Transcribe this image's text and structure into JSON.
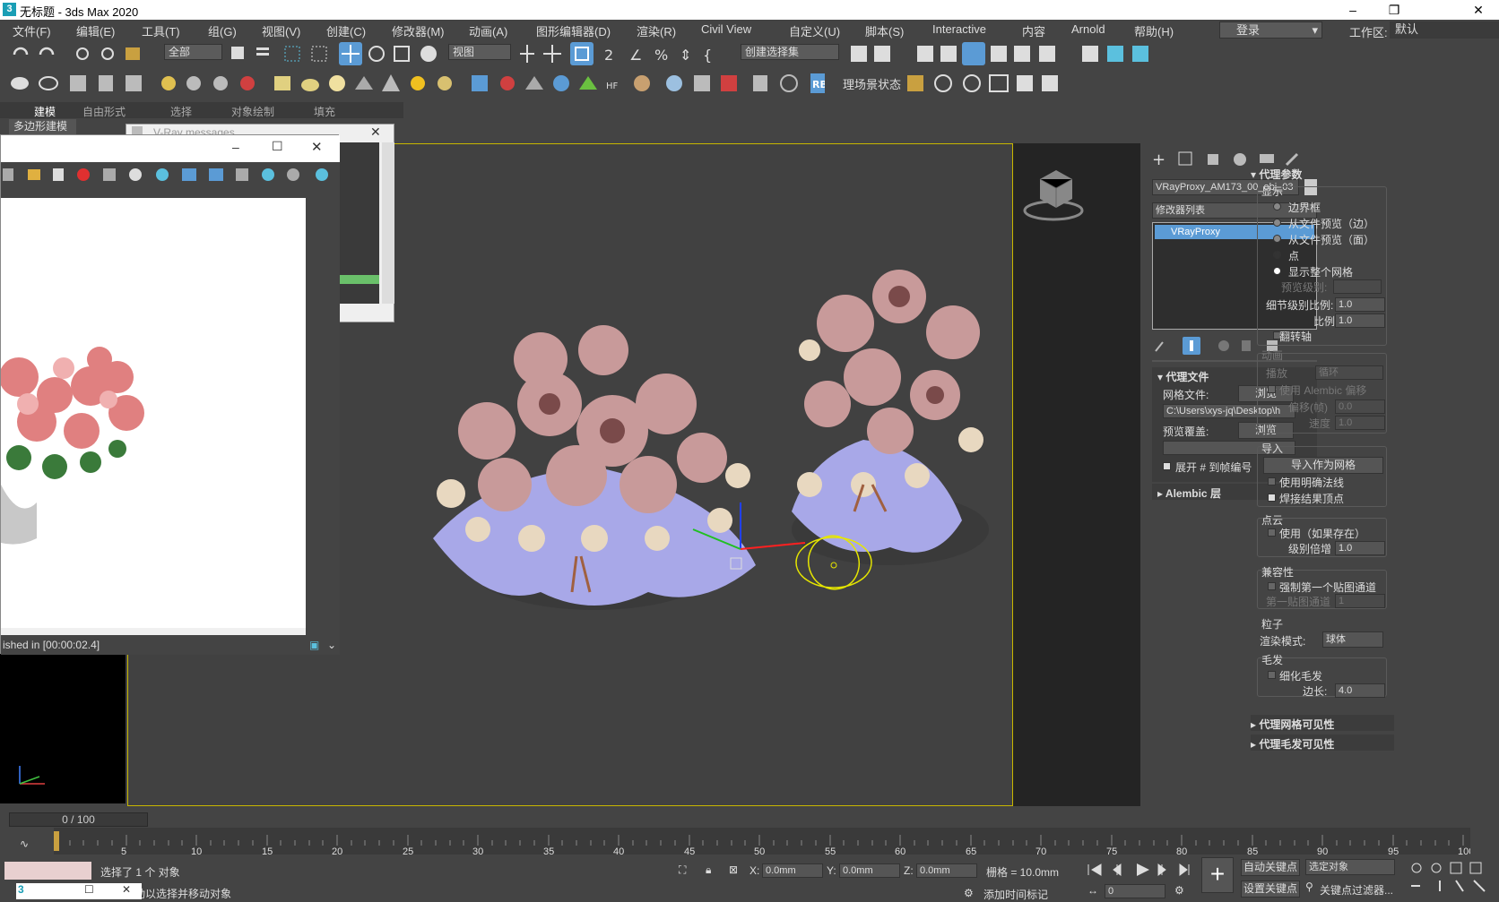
{
  "window": {
    "title": "无标题 - 3ds Max 2020",
    "min_icon": "minimize-icon",
    "max_icon": "maximize-icon",
    "close_icon": "close-icon"
  },
  "menu": [
    "文件(F)",
    "编辑(E)",
    "工具(T)",
    "组(G)",
    "视图(V)",
    "创建(C)",
    "修改器(M)",
    "动画(A)",
    "图形编辑器(D)",
    "渲染(R)",
    "Civil View",
    "自定义(U)",
    "脚本(S)",
    "Interactive",
    "内容",
    "Arnold",
    "帮助(H)"
  ],
  "login": "登录",
  "workspace": {
    "label": "工作区:",
    "value": "默认"
  },
  "toolbar": {
    "selection_filter": "全部",
    "coord_system": "视图",
    "named_selection": "创建选择集",
    "scene_explorer": "理场景状态"
  },
  "ribbon": {
    "tabs": [
      "建模",
      "自由形式",
      "选择",
      "对象绘制",
      "填充"
    ],
    "sub": "多边形建模"
  },
  "vray_messages": {
    "title": "V-Ray messages"
  },
  "vfb": {
    "status": "ished in [00:00:02.4]"
  },
  "cmd": {
    "object_name": "VRayProxy_AM173_00_obj_03",
    "modifier_list": "修改器列表",
    "stack_item": "VRayProxy",
    "proxy_file": {
      "title": "代理文件",
      "mesh_label": "网格文件:",
      "browse": "浏览",
      "path": "C:\\Users\\xys-jq\\Desktop\\h",
      "preview_label": "预览覆盖:",
      "browse2": "浏览",
      "expand": "展开 # 到帧编号"
    },
    "alembic": "Alembic 层",
    "params": {
      "title": "代理参数",
      "display": "显示",
      "radios": [
        "边界框",
        "从文件预览（边）",
        "从文件预览（面）",
        "点",
        "显示整个网格"
      ],
      "preview_level": "预览级别:",
      "lod_label": "细节级别比例:",
      "lod_val": "1.0",
      "scale_label": "比例:",
      "scale_val": "1.0",
      "flip": "翻转轴"
    },
    "anim": {
      "title": "动画",
      "playback": "播放",
      "playback_val": "循环",
      "alembic_offset": "使用 Alembic 偏移",
      "offset_label": "偏移(帧)",
      "offset_val": "0.0",
      "speed_label": "速度",
      "speed_val": "1.0"
    },
    "import": {
      "title": "导入",
      "button": "导入作为网格",
      "normals": "使用明确法线",
      "weld": "焊接结果顶点"
    },
    "pointcloud": {
      "title": "点云",
      "use": "使用（如果存在）",
      "level_label": "级别倍增",
      "level_val": "1.0"
    },
    "compat": {
      "title": "兼容性",
      "force": "强制第一个贴图通道",
      "channel": "第一贴图通道",
      "channel_val": "1"
    },
    "particles": {
      "title": "粒子",
      "mode_label": "渲染模式:",
      "mode_val": "球体"
    },
    "hair": {
      "title": "毛发",
      "subdiv": "细化毛发",
      "edge_label": "边长:",
      "edge_val": "4.0"
    },
    "rollouts": [
      "代理网格可见性",
      "代理毛发可见性"
    ]
  },
  "timeline": {
    "frame": "0 / 100",
    "ticks": [
      5,
      10,
      15,
      20,
      25,
      30,
      35,
      40,
      45,
      50,
      55,
      60,
      65,
      70,
      75,
      80,
      85,
      90,
      95,
      100
    ]
  },
  "status": {
    "selected": "选择了 1 个 对象",
    "prompt": "动以选择并移动对象",
    "x_label": "X:",
    "x": "0.0mm",
    "y_label": "Y:",
    "y": "0.0mm",
    "z_label": "Z:",
    "z": "0.0mm",
    "grid": "栅格 = 10.0mm",
    "time_tag": "添加时间标记",
    "auto_key": "自动关键点",
    "set_key": "设置关键点",
    "selected_obj": "选定对象",
    "key_filter": "关键点过滤器...",
    "frame_val": "0"
  },
  "colors": {
    "accent": "#5b9bd5",
    "viewport_border": "#c8b700",
    "gizmo": "#e6e600"
  }
}
